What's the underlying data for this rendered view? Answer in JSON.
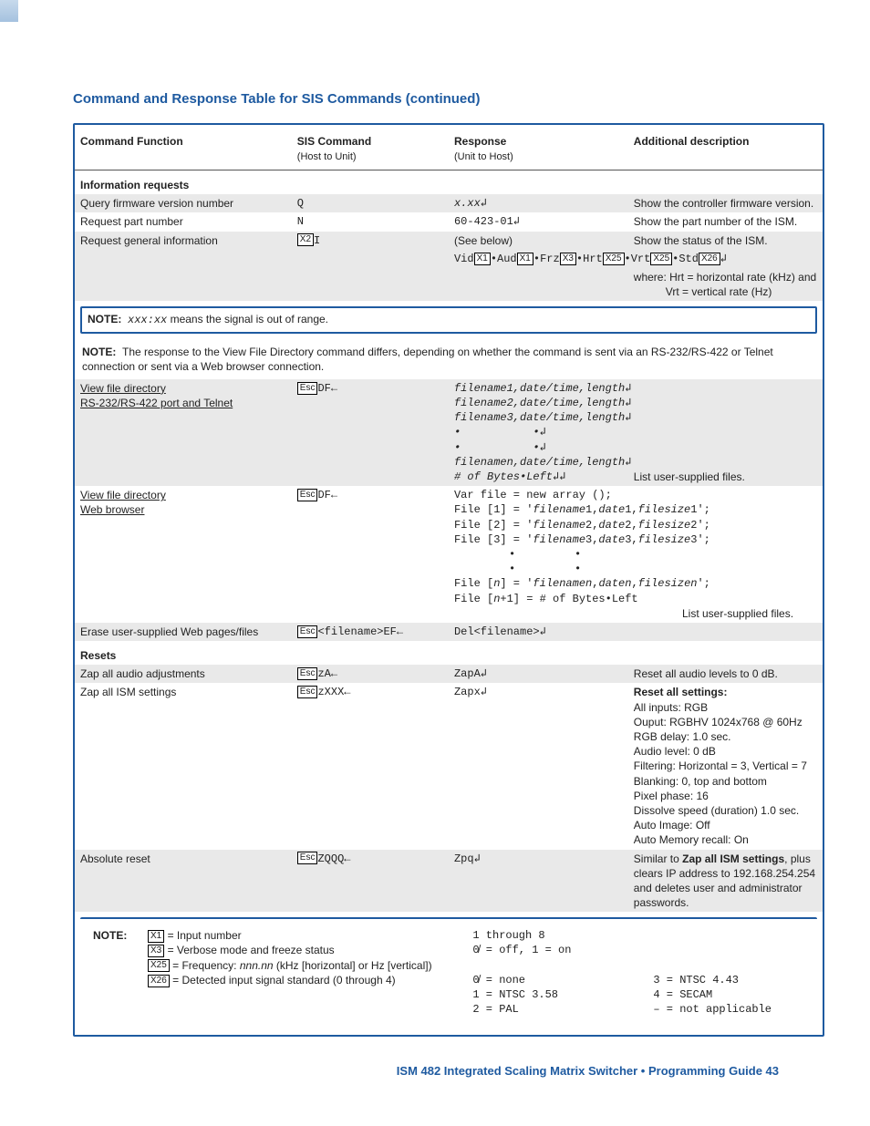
{
  "title": "Command and Response Table for SIS Commands (continued)",
  "headers": {
    "c1": "Command Function",
    "c2": "SIS Command",
    "c2sub": "(Host to Unit)",
    "c3": "Response",
    "c3sub": "(Unit to Host)",
    "c4": "Additional description"
  },
  "sections": {
    "info": "Information requests",
    "resets": "Resets"
  },
  "rows": {
    "qfw": {
      "f": "Query firmware version number",
      "c": "Q",
      "r": "x.xx↲",
      "d": "Show the controller firmware version."
    },
    "rpn": {
      "f": "Request part number",
      "c": "N",
      "r": "60-423-01↲",
      "d": "Show the part number of the ISM."
    },
    "rgi": {
      "f": "Request general information",
      "c": "",
      "r": "(See below)",
      "d": "Show the status of the ISM."
    },
    "rgi2": {
      "stat": "Vid",
      "aud": "•Aud",
      "frz": "•Frz",
      "hrt": "•Hrt",
      "vrt": "•Vrt",
      "std": "•Std",
      "end": "↲"
    },
    "rgi3": {
      "d1": "where: Hrt = horizontal rate (kHz) and",
      "d2": "Vrt = vertical rate (Hz)"
    },
    "range": "xxx:xx means the signal is out of range.",
    "note2": "The response to the View File Directory command differs, depending on whether the command is sent via an RS-232/RS-422 or Telnet connection or sent via a Web browser connection.",
    "vfd1": {
      "f1": "View file directory",
      "f2": "RS-232/RS-422 port and Telnet",
      "c": "DF←",
      "d": "List user-supplied files.",
      "r1": "filename1,date/time,length↲",
      "r2": "filename2,date/time,length↲",
      "r3": "filename3,date/time,length↲",
      "rdots1": "•           •↲",
      "rdots2": "•           •↲",
      "rn": "filenamen,date/time,length↲",
      "rb": "# of Bytes•Left↲↲"
    },
    "vfd2": {
      "f1": "View file directory",
      "f2": "Web browser",
      "c": "DF←",
      "d": "List user-supplied files.",
      "r0": "Var file = new array ();",
      "r1": "File [1] = 'filename1,date1,filesize1';",
      "r2": "File [2] = 'filename2,date2,filesize2';",
      "r3": "File [3] = 'filename3,date3,filesize3';",
      "rdots1": "•         •",
      "rdots2": "•         •",
      "rn": "File [n] = 'filenamen,daten,filesizen';",
      "rn1": "File [n+1] = # of Bytes•Left"
    },
    "erase": {
      "f": "Erase user-supplied Web pages/files",
      "c": "<filename>EF←",
      "r": "Del<filename>↲"
    },
    "zaa": {
      "f": "Zap all audio adjustments",
      "c": "zA←",
      "r": "ZapA↲",
      "d": "Reset all audio levels to 0 dB."
    },
    "zai": {
      "f": "Zap all ISM settings",
      "c": "zXXX←",
      "r": "Zapx↲",
      "d0": "Reset all settings:",
      "d1": "All inputs: RGB",
      "d2": "Ouput: RGBHV 1024x768 @ 60Hz",
      "d3": "RGB delay: 1.0 sec.",
      "d4": "Audio level: 0 dB",
      "d5": "Filtering: Horizontal = 3, Vertical = 7",
      "d6": "Blanking: 0, top and bottom",
      "d7": "Pixel phase: 16",
      "d8": "Dissolve speed (duration) 1.0 sec.",
      "d9": "Auto Image: Off",
      "d10": "Auto Memory recall: On"
    },
    "abs": {
      "f": "Absolute reset",
      "c": "ZQQQ←",
      "r": "Zpq↲",
      "d": "Similar to Zap all ISM settings, plus clears IP address to 192.168.254.254 and deletes user and administrator passwords."
    }
  },
  "note3": {
    "x1": " = Input number",
    "x1r": "1 through 8",
    "x3": " = Verbose mode and freeze status",
    "x3r": "0̸ = off, 1 = on",
    "x25": " = Frequency: nnn.nn (kHz [horizontal] or Hz [vertical])",
    "x26": " = Detected input signal standard (0 through 4)",
    "s0": "0̸ = none",
    "s1": "1 = NTSC 3.58",
    "s2": "2 = PAL",
    "s3": "3 = NTSC 4.43",
    "s4": "4 = SECAM",
    "sd": "– = not applicable"
  },
  "footer": "ISM 482 Integrated Scaling Matrix Switcher • Programming Guide    43",
  "labels": {
    "note": "NOTE:",
    "esc": "Esc",
    "x1": "X1",
    "x2": "X2",
    "x3": "X3",
    "x25": "X25",
    "x26": "X26"
  }
}
